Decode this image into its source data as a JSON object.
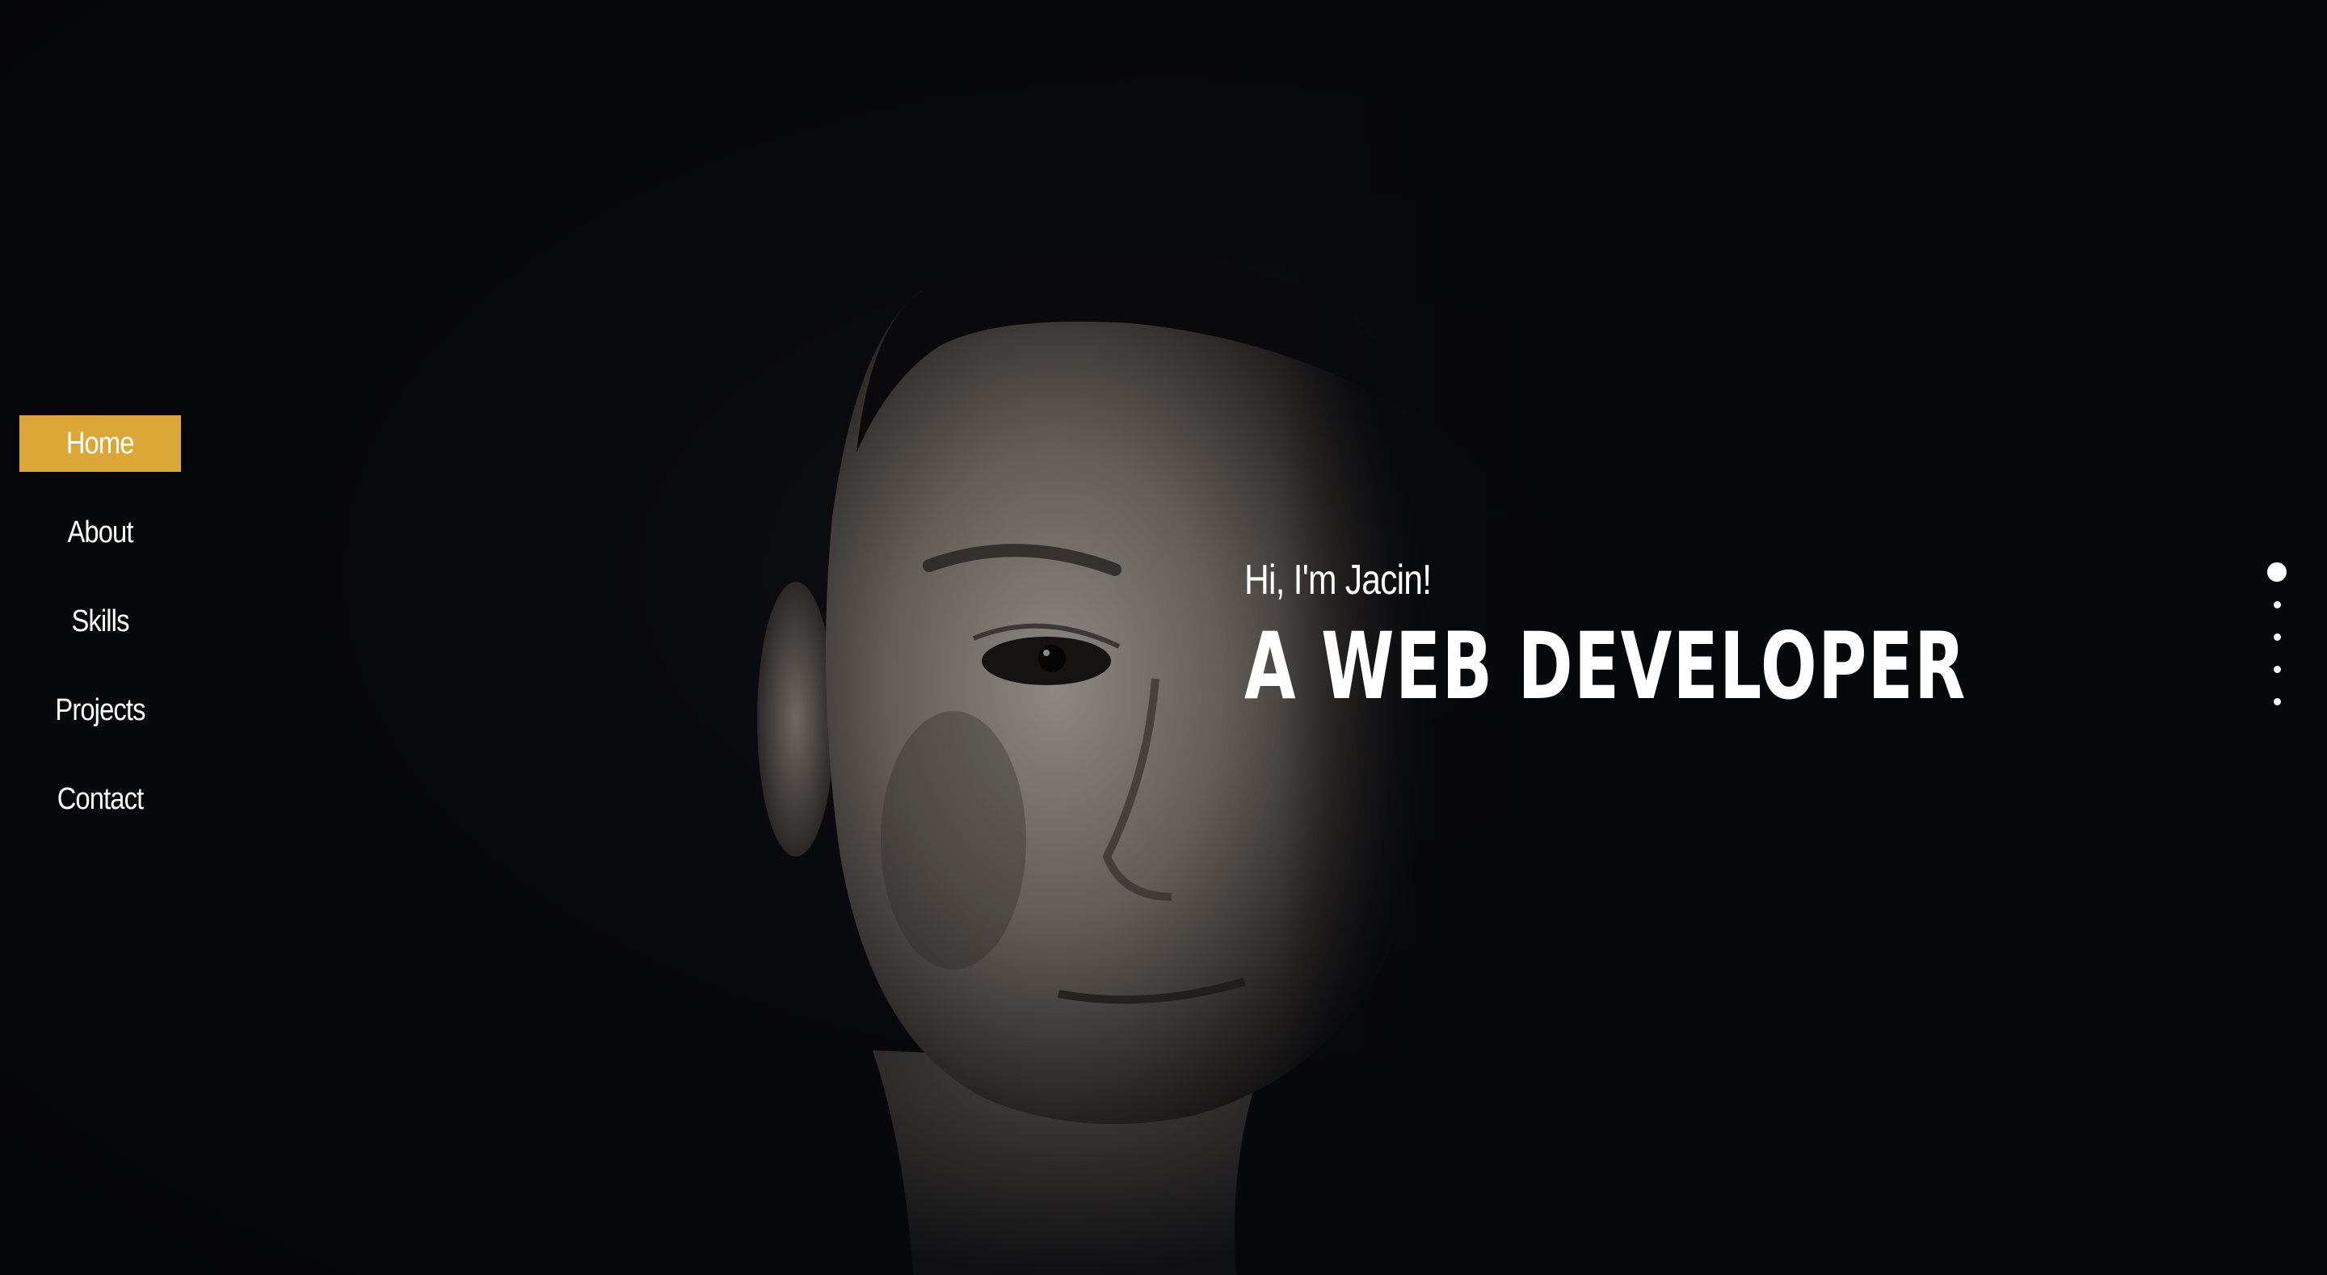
{
  "nav": {
    "items": [
      {
        "label": "Home",
        "active": true
      },
      {
        "label": "About",
        "active": false
      },
      {
        "label": "Skills",
        "active": false
      },
      {
        "label": "Projects",
        "active": false
      },
      {
        "label": "Contact",
        "active": false
      }
    ]
  },
  "hero": {
    "greeting": "Hi, I'm Jacin!",
    "headline": "A WEB DEVELOPER",
    "image": "portrait-photo"
  },
  "section_dots": {
    "count": 5,
    "active_index": 0
  },
  "colors": {
    "accent": "#dba737",
    "background": "#06070a",
    "text": "#ffffff"
  }
}
